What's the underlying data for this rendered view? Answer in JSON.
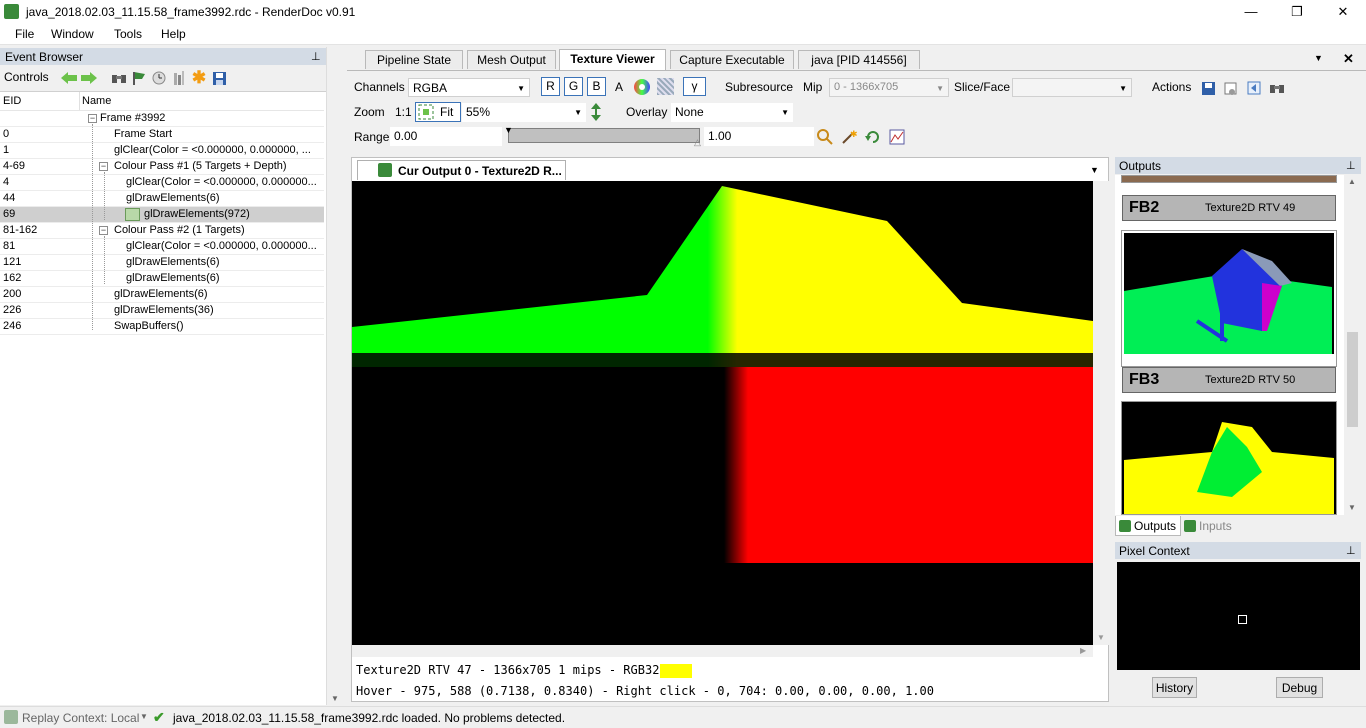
{
  "window": {
    "title": "java_2018.02.03_11.15.58_frame3992.rdc - RenderDoc v0.91",
    "minimize": "—",
    "maximize": "❐",
    "close": "✕"
  },
  "menu": [
    "File",
    "Window",
    "Tools",
    "Help"
  ],
  "event_browser": {
    "title": "Event Browser",
    "controls_label": "Controls",
    "col_eid": "EID",
    "col_name": "Name",
    "rows": [
      {
        "eid": "",
        "name": "Frame #3992"
      },
      {
        "eid": "0",
        "name": "Frame Start"
      },
      {
        "eid": "1",
        "name": "glClear(Color = <0.000000, 0.000000, ..."
      },
      {
        "eid": "4-69",
        "name": "Colour Pass #1 (5 Targets + Depth)"
      },
      {
        "eid": "4",
        "name": "glClear(Color = <0.000000, 0.000000..."
      },
      {
        "eid": "44",
        "name": "glDrawElements(6)"
      },
      {
        "eid": "69",
        "name": "glDrawElements(972)"
      },
      {
        "eid": "81-162",
        "name": "Colour Pass #2 (1 Targets)"
      },
      {
        "eid": "81",
        "name": "glClear(Color = <0.000000, 0.000000..."
      },
      {
        "eid": "121",
        "name": "glDrawElements(6)"
      },
      {
        "eid": "162",
        "name": "glDrawElements(6)"
      },
      {
        "eid": "200",
        "name": "glDrawElements(6)"
      },
      {
        "eid": "226",
        "name": "glDrawElements(36)"
      },
      {
        "eid": "246",
        "name": "SwapBuffers()"
      }
    ]
  },
  "tabs": [
    "Pipeline State",
    "Mesh Output",
    "Texture Viewer",
    "Capture Executable",
    "java [PID 414556]"
  ],
  "toolbar": {
    "channels_label": "Channels",
    "channels_value": "RGBA",
    "r": "R",
    "g": "G",
    "b": "B",
    "a": "A",
    "gamma": "γ",
    "subresource_label": "Subresource",
    "mip_label": "Mip",
    "mip_value": "0 - 1366x705",
    "slice_label": "Slice/Face",
    "actions_label": "Actions",
    "zoom_label": "Zoom",
    "zoom_1to1": "1:1",
    "fit_label": "Fit",
    "zoom_value": "55%",
    "overlay_label": "Overlay",
    "overlay_value": "None",
    "range_label": "Range",
    "range_min": "0.00",
    "range_max": "1.00"
  },
  "viewer": {
    "tab_title": "Cur Output 0 - Texture2D R...",
    "status_line1": "Texture2D RTV 47 - 1366x705 1 mips - RGB32F",
    "status_line2": "Hover -  975,  588 (0.7138, 0.8340) - Right click -    0,  704: 0.00, 0.00, 0.00, 1.00",
    "swatch_color": "#ffff00"
  },
  "outputs": {
    "title": "Outputs",
    "thumbs": [
      {
        "big": "FB2",
        "small": "Texture2D RTV 49"
      },
      {
        "big": "FB3",
        "small": "Texture2D RTV 50"
      }
    ],
    "tab_outputs": "Outputs",
    "tab_inputs": "Inputs"
  },
  "pixel_context": {
    "title": "Pixel Context",
    "history": "History",
    "debug": "Debug"
  },
  "statusbar": {
    "replay": "Replay Context: Local",
    "message": "java_2018.02.03_11.15.58_frame3992.rdc loaded. No problems detected."
  },
  "colors": {
    "accent_green": "#3a8a3a",
    "selection": "#cfcfcf",
    "panel_header": "#d3dbe5"
  }
}
